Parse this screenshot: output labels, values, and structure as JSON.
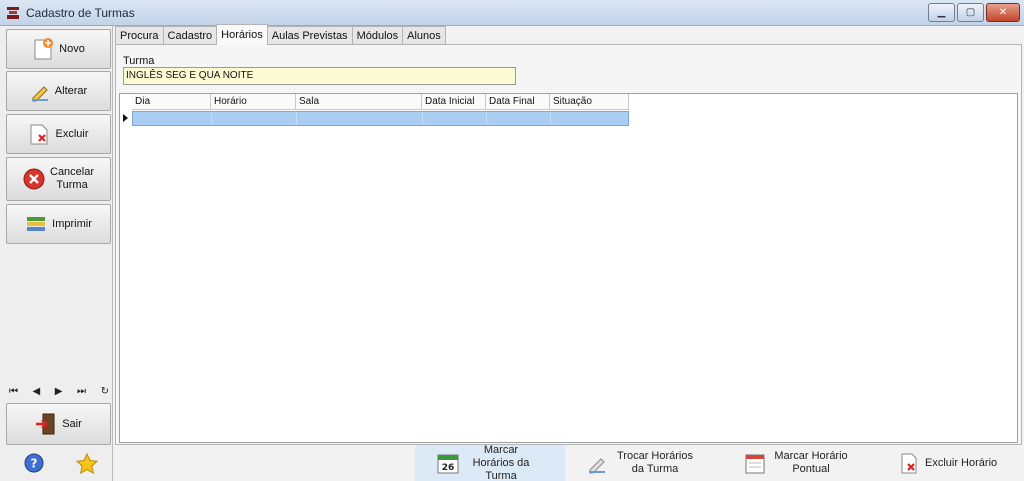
{
  "window": {
    "title": "Cadastro de Turmas"
  },
  "sidebar": {
    "buttons": [
      {
        "label": "Novo",
        "icon": "new-document-icon"
      },
      {
        "label": "Alterar",
        "icon": "edit-pencil-icon"
      },
      {
        "label": "Excluir",
        "icon": "delete-document-icon"
      },
      {
        "label": "Cancelar Turma",
        "icon": "cancel-red-x-icon"
      },
      {
        "label": "Imprimir",
        "icon": "printer-icon"
      },
      {
        "label": "Sair",
        "icon": "exit-door-icon"
      }
    ],
    "nav": [
      "⏮",
      "◀",
      "▶",
      "⏭",
      "↻"
    ]
  },
  "tabs": [
    "Procura",
    "Cadastro",
    "Horários",
    "Aulas Previstas",
    "Módulos",
    "Alunos"
  ],
  "active_tab": "Horários",
  "form": {
    "turma_label": "Turma",
    "turma_value": "INGLÊS SEG E QUA NOITE"
  },
  "grid": {
    "columns": [
      "Dia",
      "Horário",
      "Sala",
      "Data Inicial",
      "Data Final",
      "Situação"
    ]
  },
  "actions": [
    {
      "label": "Marcar Horários da Turma",
      "icon": "calendar-26-icon"
    },
    {
      "label": "Trocar Horários da Turma",
      "icon": "edit-pencil-icon"
    },
    {
      "label": "Marcar Horário Pontual",
      "icon": "calendar-icon"
    },
    {
      "label": "Excluir Horário",
      "icon": "delete-document-icon"
    }
  ],
  "colors": {
    "selected_row": "#a9cdf3",
    "field_bg": "#fdfbd3",
    "titlebar": "#c3d3e8"
  }
}
